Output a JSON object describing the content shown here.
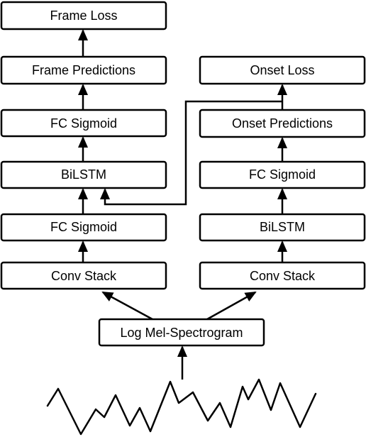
{
  "left_column": {
    "frame_loss": "Frame Loss",
    "frame_predictions": "Frame Predictions",
    "fc_sigmoid_top": "FC Sigmoid",
    "bilstm": "BiLSTM",
    "fc_sigmoid_bottom": "FC Sigmoid",
    "conv_stack": "Conv Stack"
  },
  "right_column": {
    "onset_loss": "Onset Loss",
    "onset_predictions": "Onset Predictions",
    "fc_sigmoid": "FC Sigmoid",
    "bilstm": "BiLSTM",
    "conv_stack": "Conv Stack"
  },
  "input": {
    "spectrogram": "Log Mel-Spectrogram",
    "waveform_icon": "audio-waveform"
  }
}
